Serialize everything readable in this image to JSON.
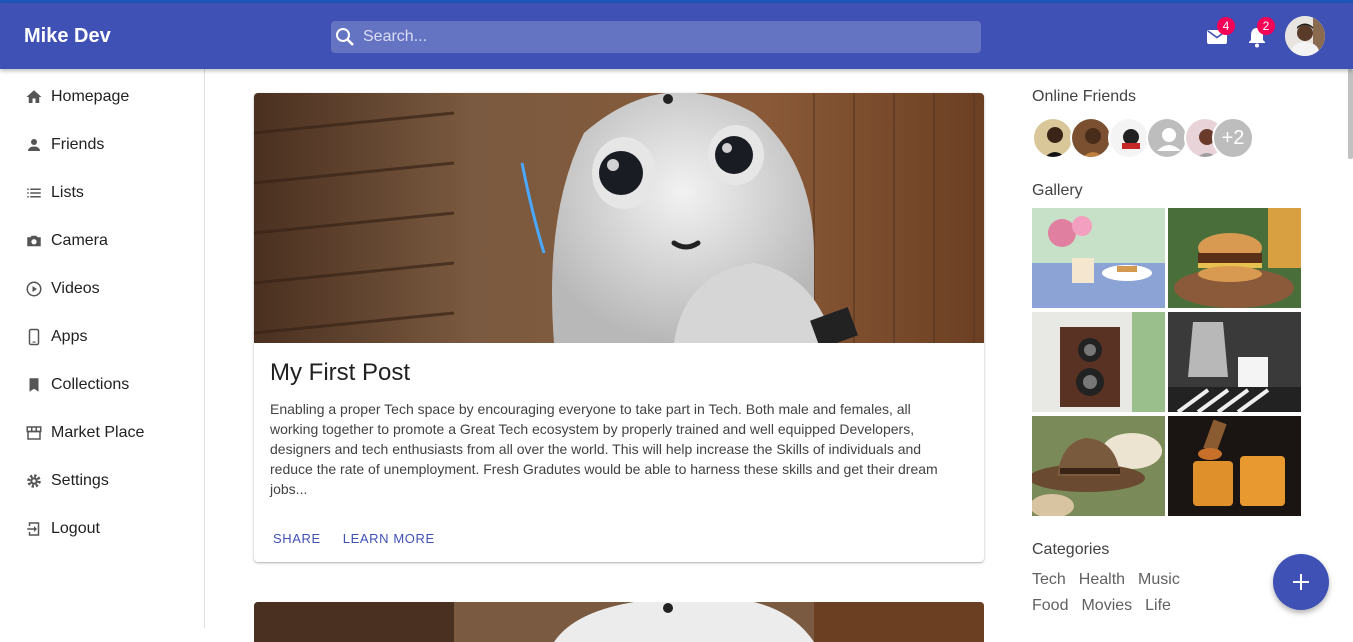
{
  "app": {
    "title": "Mike Dev"
  },
  "search": {
    "placeholder": "Search..."
  },
  "header": {
    "mail_count": "4",
    "notification_count": "2"
  },
  "sidebar": {
    "items": [
      {
        "label": "Homepage",
        "icon": "home-icon"
      },
      {
        "label": "Friends",
        "icon": "person-icon"
      },
      {
        "label": "Lists",
        "icon": "list-icon"
      },
      {
        "label": "Camera",
        "icon": "camera-icon"
      },
      {
        "label": "Videos",
        "icon": "play-circle-icon"
      },
      {
        "label": "Apps",
        "icon": "phone-icon"
      },
      {
        "label": "Collections",
        "icon": "bookmark-icon"
      },
      {
        "label": "Market Place",
        "icon": "storefront-icon"
      },
      {
        "label": "Settings",
        "icon": "gear-icon"
      },
      {
        "label": "Logout",
        "icon": "logout-icon"
      }
    ]
  },
  "post": {
    "title": "My First Post",
    "body": "Enabling a proper Tech space by encouraging everyone to take part in Tech. Both male and females, all working together to promote a Great Tech ecosystem by properly trained and well equipped Developers, designers and tech enthusiasts from all over the world. This will help increase the Skills of individuals and reduce the rate of unemployment. Fresh Gradutes would be able to harness these skills and get their dream jobs...",
    "share_label": "SHARE",
    "learn_more_label": "LEARN MORE"
  },
  "right": {
    "online_friends_title": "Online Friends",
    "more_friends": "+2",
    "gallery_title": "Gallery",
    "categories_title": "Categories",
    "categories": [
      "Tech",
      "Health",
      "Music",
      "Food",
      "Movies",
      "Life"
    ]
  },
  "colors": {
    "primary": "#3f51b5",
    "badge": "#f50057"
  }
}
